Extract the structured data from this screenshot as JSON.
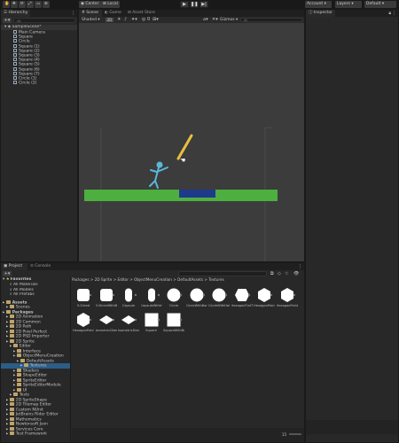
{
  "toolbar": {
    "pivot": "Center",
    "space": "Local",
    "account": "Account",
    "layers": "Layers",
    "layout": "Default"
  },
  "hierarchy": {
    "tab": "Hierarchy",
    "search_placeholder": "All",
    "scene": "SampleScene*",
    "items": [
      "Main Camera",
      "Square",
      "Circle",
      "Square (1)",
      "Square (2)",
      "Square (3)",
      "Square (4)",
      "Square (5)",
      "Square (6)",
      "Square (7)",
      "Circle (1)",
      "Circle (2)"
    ]
  },
  "scene": {
    "tabs": [
      "Scene",
      "Game",
      "Asset Store"
    ],
    "shading": "Shaded",
    "mode2d": "2D",
    "gizmos": "Gizmos",
    "search_placeholder": "All"
  },
  "inspector": {
    "tab": "Inspector"
  },
  "project": {
    "tabs": [
      "Project",
      "Console"
    ],
    "favorites_label": "Favorites",
    "favorites": [
      "All Materials",
      "All Models",
      "All Prefabs"
    ],
    "tree": [
      {
        "label": "Assets",
        "level": 0
      },
      {
        "label": "Scenes",
        "level": 1
      },
      {
        "label": "Packages",
        "level": 0
      },
      {
        "label": "2D Animation",
        "level": 1
      },
      {
        "label": "2D Common",
        "level": 1
      },
      {
        "label": "2D Path",
        "level": 1
      },
      {
        "label": "2D Pixel Perfect",
        "level": 1
      },
      {
        "label": "2D PSD Importer",
        "level": 1
      },
      {
        "label": "2D Sprite",
        "level": 1
      },
      {
        "label": "Editor",
        "level": 2
      },
      {
        "label": "Interface",
        "level": 3
      },
      {
        "label": "ObjectMenuCreation",
        "level": 3
      },
      {
        "label": "DefaultAssets",
        "level": 4
      },
      {
        "label": "Textures",
        "level": 5
      },
      {
        "label": "Shaders",
        "level": 3
      },
      {
        "label": "ShapeEditor",
        "level": 3
      },
      {
        "label": "SpriteEditor",
        "level": 3
      },
      {
        "label": "SpriteEditorModule",
        "level": 3
      },
      {
        "label": "UI",
        "level": 3
      },
      {
        "label": "Tests",
        "level": 2
      },
      {
        "label": "2D SpriteShape",
        "level": 1
      },
      {
        "label": "2D Tilemap Editor",
        "level": 1
      },
      {
        "label": "Custom NUnit",
        "level": 1
      },
      {
        "label": "JetBrains Rider Editor",
        "level": 1
      },
      {
        "label": "Mathematics",
        "level": 1
      },
      {
        "label": "Newtonsoft Json",
        "level": 1
      },
      {
        "label": "Services Core",
        "level": 1
      },
      {
        "label": "Test Framework",
        "level": 1
      }
    ],
    "breadcrumb": [
      "Packages",
      "2D Sprite",
      "Editor",
      "ObjectMenuCreation",
      "DefaultAssets",
      "Textures"
    ],
    "assets": [
      {
        "label": "9-Sliced",
        "shape": "rounded-square"
      },
      {
        "label": "9-SlicedWithBorder",
        "shape": "rounded-square"
      },
      {
        "label": "Capsule",
        "shape": "capsule"
      },
      {
        "label": "CapsuleWithHoleInIt",
        "shape": "capsule"
      },
      {
        "label": "Circle",
        "shape": "circle"
      },
      {
        "label": "CircleWithBorder",
        "shape": "circle"
      },
      {
        "label": "CircleWithHoleInIt",
        "shape": "circle"
      },
      {
        "label": "HexagonFlatTop",
        "shape": "hex-flat"
      },
      {
        "label": "HexagonPointTop",
        "shape": "hex-point"
      },
      {
        "label": "HexagonPointTopWithBorder",
        "shape": "hex-point"
      },
      {
        "label": "HexagonPointTopWithHole",
        "shape": "hex-point"
      },
      {
        "label": "IsometricDiamond",
        "shape": "diamond"
      },
      {
        "label": "IsometricDiamondWithBorder",
        "shape": "diamond"
      },
      {
        "label": "Square",
        "shape": "square"
      },
      {
        "label": "SquareWithBorder",
        "shape": "square"
      }
    ],
    "asset_count": "15"
  },
  "colors": {
    "ground": "#4caf40",
    "block": "#1f3a8a",
    "stick": "#e8c040",
    "figure": "#5ab8d8",
    "sky": "#3a3a3a"
  }
}
